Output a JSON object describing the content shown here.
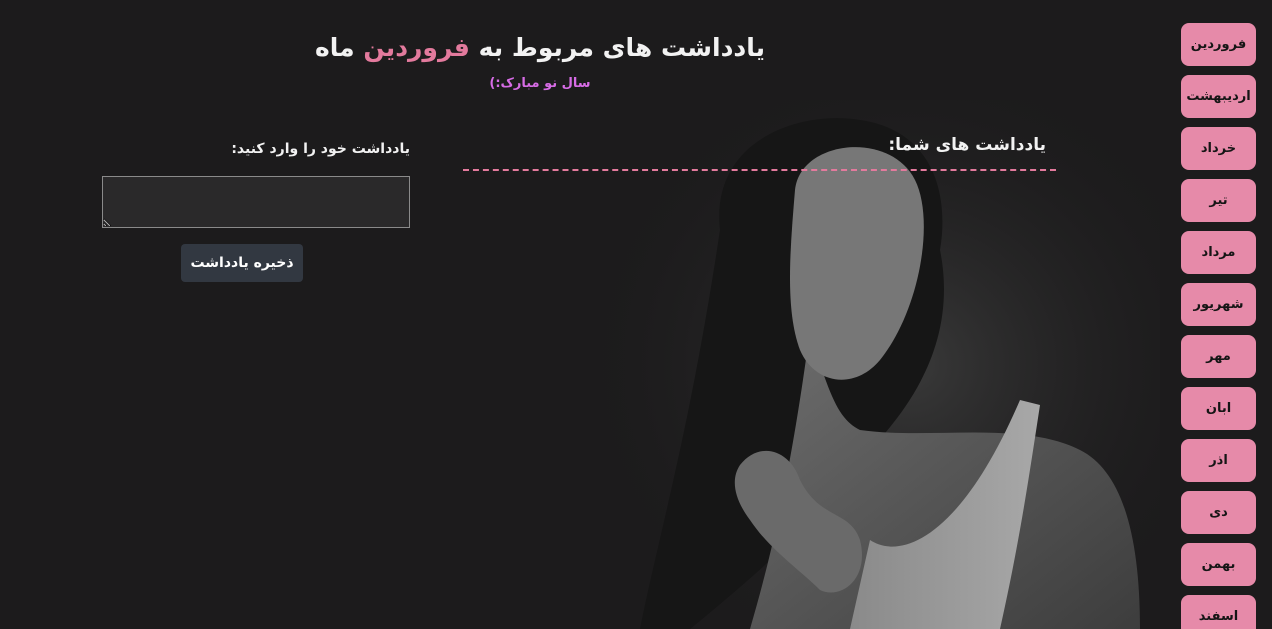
{
  "header": {
    "title_prefix": "یادداشت های مربوط به",
    "title_month": "فروردین",
    "title_suffix": "ماه",
    "subtitle": "سال نو مبارک:)"
  },
  "notes": {
    "heading": "یادداشت های شما:"
  },
  "entry": {
    "label": "یادداشت خود را وارد کنید:",
    "value": "",
    "save_label": "ذخیره یادداشت"
  },
  "months": [
    {
      "label": "فروردین"
    },
    {
      "label": "اردیبهشت"
    },
    {
      "label": "خرداد"
    },
    {
      "label": "تیر"
    },
    {
      "label": "مرداد"
    },
    {
      "label": "شهریور"
    },
    {
      "label": "مهر"
    },
    {
      "label": "ابان"
    },
    {
      "label": "اذر"
    },
    {
      "label": "دی"
    },
    {
      "label": "بهمن"
    },
    {
      "label": "اسفند"
    }
  ],
  "colors": {
    "background": "#1c1b1c",
    "accent_pink": "#e37a9d",
    "month_button": "#e68aa9",
    "subtitle_purple": "#d76ce6",
    "save_button": "#323841"
  },
  "background_image": "grayscale-portrait-woman"
}
